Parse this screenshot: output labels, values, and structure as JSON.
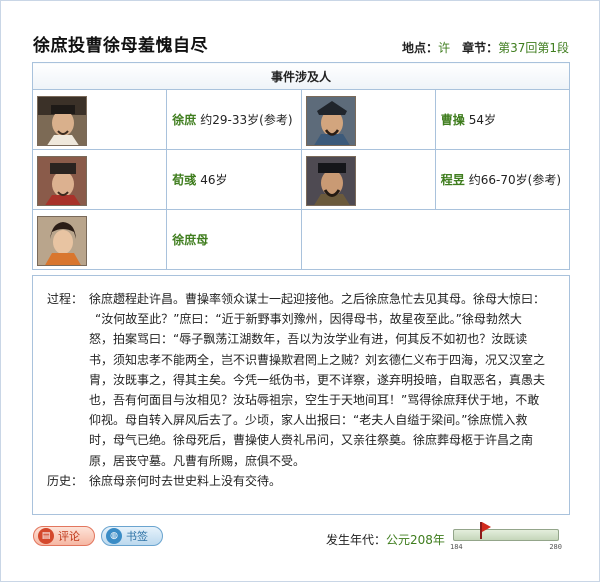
{
  "event": {
    "title": "徐庶投曹徐母羞愧自尽",
    "location_label": "地点：",
    "location_value": "许",
    "chapter_label": "章节：",
    "chapter_value": "第37回第1段"
  },
  "people_section": {
    "heading": "事件涉及人",
    "people": [
      {
        "name": "徐庶",
        "age": "约29-33岁(参考)",
        "avatar": "portrait-xu-shu"
      },
      {
        "name": "曹操",
        "age": "54岁",
        "avatar": "portrait-cao-cao"
      },
      {
        "name": "荀彧",
        "age": "46岁",
        "avatar": "portrait-xun-yu"
      },
      {
        "name": "程昱",
        "age": "约66-70岁(参考)",
        "avatar": "portrait-cheng-yu"
      },
      {
        "name": "徐庶母",
        "age": "",
        "avatar": "portrait-xu-shu-mother"
      }
    ]
  },
  "story": {
    "process_label": "过程：",
    "process_lines": [
      "徐庶趱程赴许昌。曹操率领众谋士一起迎接他。之后徐庶急忙去见其母。徐母大惊曰：",
      "“汝何故至此？”庶曰：“近于新野事刘豫州，因得母书，故星夜至此。”徐母勃然大",
      "怒，拍案骂曰：“辱子飘荡江湖数年，吾以为汝学业有进，何其反不如初也？汝既读",
      "书，须知忠孝不能两全，岂不识曹操欺君罔上之贼？刘玄德仁义布于四海，况又汉室之",
      "胄，汝既事之，得其主矣。今凭一纸伪书，更不详察，遂弃明投暗，自取恶名，真愚夫",
      "也，吾有何面目与汝相见？汝玷辱祖宗，空生于天地间耳！”骂得徐庶拜伏于地，不敢",
      "仰视。母自转入屏风后去了。少顷，家人出报曰：“老夫人自缢于梁间。”徐庶慌入救",
      "时，母气已绝。徐母死后，曹操使人赍礼吊问，又亲往祭奠。徐庶葬母柩于许昌之南",
      "原，居丧守墓。凡曹有所赐，庶俱不受。"
    ],
    "history_label": "历史：",
    "history_text": "徐庶母亲何时去世史料上没有交待。"
  },
  "actions": {
    "comment_label": "评论",
    "bookmark_label": "书签"
  },
  "era": {
    "label": "发生年代：",
    "value": "公元208年",
    "timeline_start": "184",
    "timeline_end": "280",
    "year": 208
  },
  "colors": {
    "accent_green": "#3f7d1e",
    "border_blue": "#a9c2dc"
  }
}
